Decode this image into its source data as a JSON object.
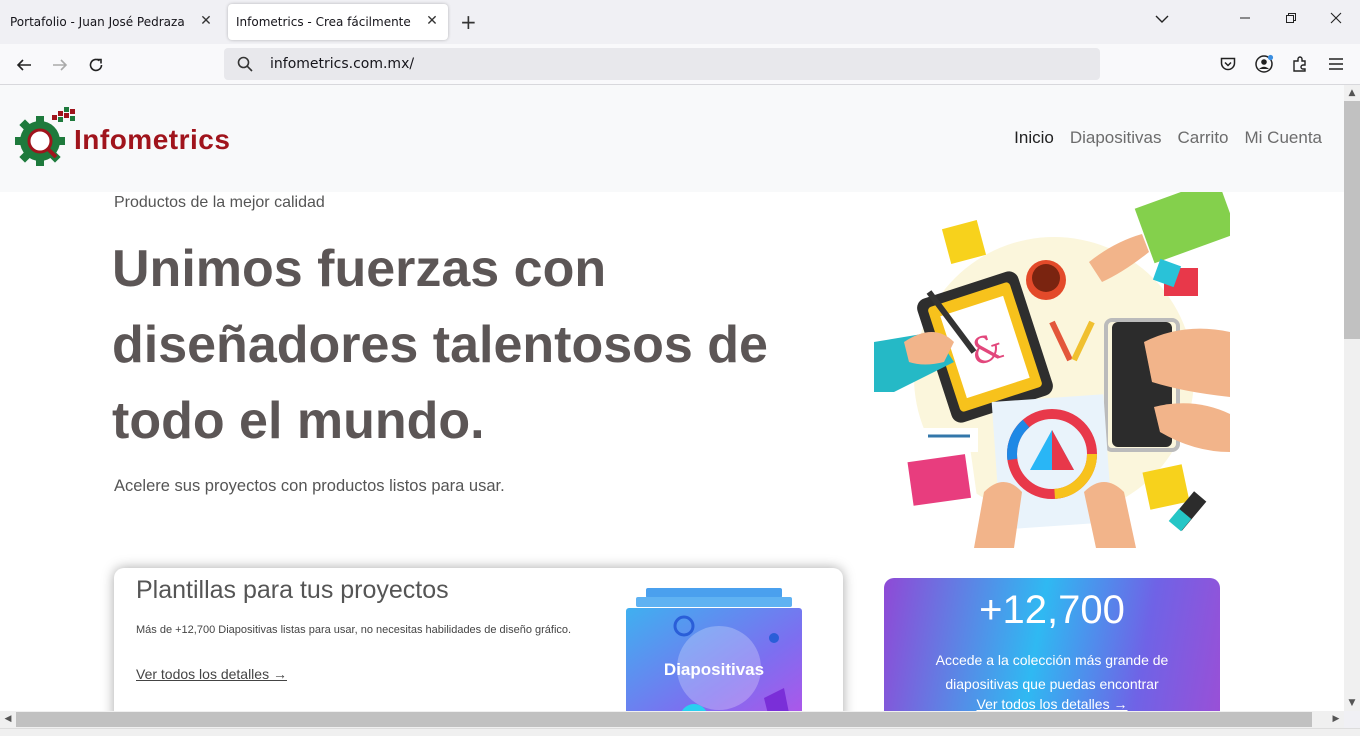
{
  "browser": {
    "tabs": [
      {
        "title": "Portafolio - Juan José Pedraza"
      },
      {
        "title": "Infometrics - Crea fácilmente"
      }
    ],
    "url": "infometrics.com.mx/"
  },
  "site": {
    "logo_text": "Infometrics",
    "menu": [
      "Inicio",
      "Diapositivas",
      "Carrito",
      "Mi Cuenta"
    ],
    "hero": {
      "kicker": "Productos de la mejor calidad",
      "headline": "Unimos fuerzas con diseñadores talentosos de todo el mundo.",
      "lead": "Acelere sus proyectos con productos listos para usar."
    },
    "card_templates": {
      "title": "Plantillas para tus proyectos",
      "text": "Más de +12,700 Diapositivas listas para usar, no necesitas habilidades de diseño gráfico.",
      "link": "Ver todos los detalles →",
      "image_label": "Diapositivas"
    },
    "card_stats": {
      "big": "+12,700",
      "desc": "Accede a la colección más grande de diapositivas que puedas encontrar",
      "link": "Ver todos los detalles →"
    }
  },
  "colors": {
    "brand_red": "#a0141c",
    "brand_green": "#1e7a3c",
    "headline": "#5c5656"
  }
}
